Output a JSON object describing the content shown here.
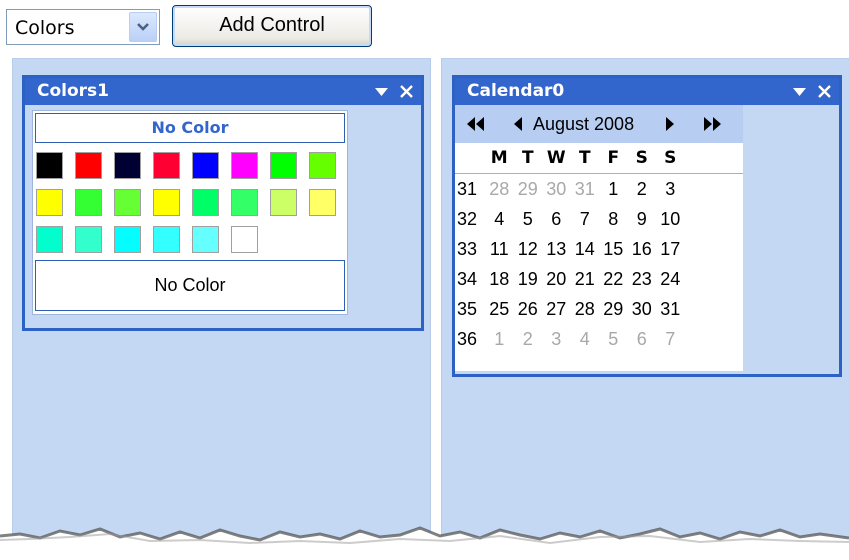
{
  "toolbar": {
    "control_select": {
      "value": "Colors",
      "icon": "chevron-down-icon"
    },
    "add_button_label": "Add Control"
  },
  "colors_part": {
    "title": "Colors1",
    "no_color_header": "No Color",
    "no_color_button": "No Color",
    "swatches": [
      [
        "#000000",
        "#ff0000",
        "#000033",
        "#ff0033",
        "#0000ff",
        "#ff00ff",
        "#00ff00",
        "#66ff00"
      ],
      [
        "#ffff00",
        "#33ff33",
        "#66ff33",
        "#ffff00",
        "#00ff66",
        "#33ff66",
        "#ccff66",
        "#ffff66"
      ],
      [
        "#00ffcc",
        "#33ffcc",
        "#00ffff",
        "#33ffff",
        "#66ffff",
        "#ffffff"
      ]
    ]
  },
  "calendar_part": {
    "title": "Calendar0",
    "month_label": "August 2008",
    "nav": {
      "prev_year": "◀◀",
      "prev_month": "◀",
      "next_month": "▶",
      "next_year": "▶▶"
    },
    "day_headers": [
      "M",
      "T",
      "W",
      "T",
      "F",
      "S",
      "S"
    ],
    "weeks": [
      {
        "week": "31",
        "days": [
          "28",
          "29",
          "30",
          "31",
          "1",
          "2",
          "3"
        ],
        "other": [
          true,
          true,
          true,
          true,
          false,
          false,
          false
        ]
      },
      {
        "week": "32",
        "days": [
          "4",
          "5",
          "6",
          "7",
          "8",
          "9",
          "10"
        ],
        "other": [
          false,
          false,
          false,
          false,
          false,
          false,
          false
        ]
      },
      {
        "week": "33",
        "days": [
          "11",
          "12",
          "13",
          "14",
          "15",
          "16",
          "17"
        ],
        "other": [
          false,
          false,
          false,
          false,
          false,
          false,
          false
        ]
      },
      {
        "week": "34",
        "days": [
          "18",
          "19",
          "20",
          "21",
          "22",
          "23",
          "24"
        ],
        "other": [
          false,
          false,
          false,
          false,
          false,
          false,
          false
        ]
      },
      {
        "week": "35",
        "days": [
          "25",
          "26",
          "27",
          "28",
          "29",
          "30",
          "31"
        ],
        "other": [
          false,
          false,
          false,
          false,
          false,
          false,
          false
        ]
      },
      {
        "week": "36",
        "days": [
          "1",
          "2",
          "3",
          "4",
          "5",
          "6",
          "7"
        ],
        "other": [
          true,
          true,
          true,
          true,
          true,
          true,
          true
        ]
      }
    ]
  },
  "part_tools": {
    "menu_icon": "dropdown-triangle-icon",
    "close_icon": "close-icon"
  },
  "colors": {
    "zone_bg": "#c4d8f4",
    "title_bar": "#3366cc",
    "accent_text": "#3366cc",
    "calendar_nav_bg": "#b7cdf2"
  }
}
